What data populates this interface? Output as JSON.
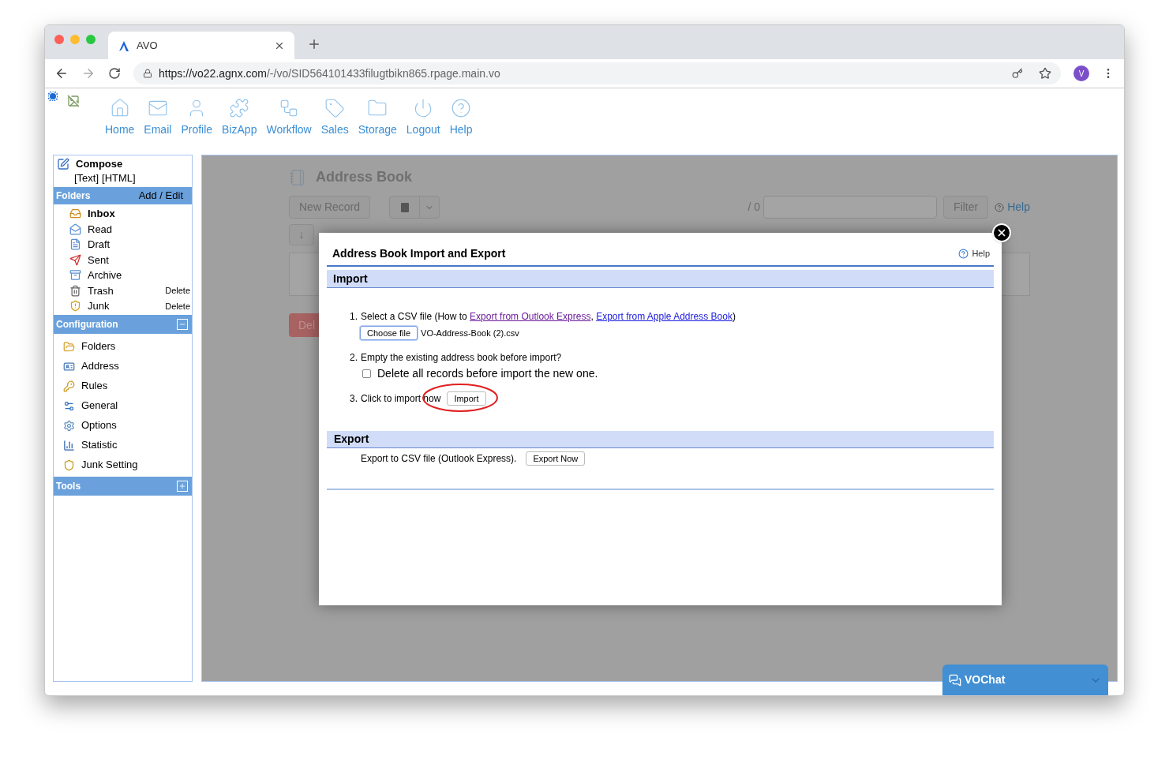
{
  "browser": {
    "tab_title": "AVO",
    "url_host": "https://vo22.agnx.com",
    "url_path": "/-/vo/SID564101433filugtbikn865.rpage.main.vo",
    "avatar": "V"
  },
  "nav": [
    {
      "kind": "home",
      "label": "Home"
    },
    {
      "kind": "mail",
      "label": "Email"
    },
    {
      "kind": "user",
      "label": "Profile"
    },
    {
      "kind": "puzzle",
      "label": "BizApp"
    },
    {
      "kind": "flow",
      "label": "Workflow"
    },
    {
      "kind": "tag",
      "label": "Sales"
    },
    {
      "kind": "folder",
      "label": "Storage"
    },
    {
      "kind": "power",
      "label": "Logout"
    },
    {
      "kind": "help",
      "label": "Help"
    }
  ],
  "sidebar": {
    "compose": {
      "title": "Compose",
      "links": [
        "[Text]",
        "[HTML]"
      ]
    },
    "folders": {
      "title": "Folders",
      "action": "Add / Edit",
      "items": [
        {
          "kind": "inbox",
          "label": "Inbox",
          "selected": true
        },
        {
          "kind": "read",
          "label": "Read",
          "selected": false
        },
        {
          "kind": "draft",
          "label": "Draft",
          "selected": false
        },
        {
          "kind": "sent",
          "label": "Sent",
          "selected": false
        },
        {
          "kind": "archive",
          "label": "Archive",
          "selected": false
        },
        {
          "kind": "trash",
          "label": "Trash",
          "selected": false,
          "action": "Delete"
        },
        {
          "kind": "junk",
          "label": "Junk",
          "selected": false,
          "action": "Delete"
        }
      ]
    },
    "configuration": {
      "title": "Configuration",
      "expanded": true,
      "items": [
        {
          "kind": "folders",
          "label": "Folders"
        },
        {
          "kind": "address",
          "label": "Address"
        },
        {
          "kind": "rules",
          "label": "Rules"
        },
        {
          "kind": "general",
          "label": "General"
        },
        {
          "kind": "options",
          "label": "Options"
        },
        {
          "kind": "statistic",
          "label": "Statistic"
        },
        {
          "kind": "junk",
          "label": "Junk Setting"
        }
      ]
    },
    "tools": {
      "title": "Tools",
      "expanded": false
    }
  },
  "page": {
    "title": "Address Book",
    "new_record": "New Record",
    "count": "/ 0",
    "filter": "Filter",
    "help": "Help",
    "sort": "↓",
    "delete": "Del"
  },
  "dialog": {
    "title": "Address Book Import and Export",
    "help": "Help",
    "import": {
      "title": "Import",
      "step1": {
        "number": "1.",
        "parts": [
          {
            "kind": "text",
            "text": "Select a CSV file (How to "
          },
          {
            "kind": "link",
            "text": "Export from Outlook Express",
            "visited": true
          },
          {
            "kind": "text",
            "text": ", "
          },
          {
            "kind": "link",
            "text": "Export from Apple Address Book",
            "visited": false
          },
          {
            "kind": "text",
            "text": ")"
          }
        ],
        "choose": "Choose file",
        "file": "VO-Address-Book (2).csv"
      },
      "step2": {
        "number": "2.",
        "text": "Empty the existing address book before import?",
        "checkbox": {
          "label": "Delete all records before import the new one.",
          "checked": false
        }
      },
      "step3": {
        "number": "3.",
        "text": "Click to import now",
        "button": "Import",
        "circled": true
      }
    },
    "export": {
      "title": "Export",
      "text": "Export to CSV file (Outlook Express).",
      "button": "Export Now"
    }
  },
  "chat": {
    "title": "VOChat"
  }
}
